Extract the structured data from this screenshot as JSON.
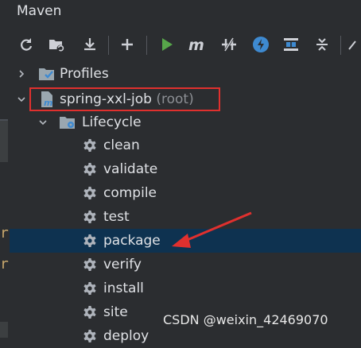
{
  "panel": {
    "title": "Maven"
  },
  "toolbar": [
    {
      "name": "reload-icon"
    },
    {
      "name": "generate-sources-icon"
    },
    {
      "name": "download-icon"
    },
    {
      "name": "add-icon"
    },
    {
      "name": "run-icon"
    },
    {
      "name": "execute-goal-icon"
    },
    {
      "name": "toggle-offline-icon"
    },
    {
      "name": "skip-tests-icon"
    },
    {
      "name": "show-dependencies-icon"
    },
    {
      "name": "collapse-all-icon"
    }
  ],
  "tree": {
    "profiles": "Profiles",
    "project": {
      "name": "spring-xxl-job",
      "suffix": "(root)"
    },
    "lifecycle": "Lifecycle",
    "goals": [
      "clean",
      "validate",
      "compile",
      "test",
      "package",
      "verify",
      "install",
      "site",
      "deploy"
    ],
    "selected_goal": "package"
  },
  "colors": {
    "selection": "#0e3250",
    "highlight_box": "#e0302e",
    "arrow": "#e0302e"
  },
  "watermark": "CSDN @weixin_42469070",
  "left_edge_glyphs": [
    "r",
    "r"
  ]
}
